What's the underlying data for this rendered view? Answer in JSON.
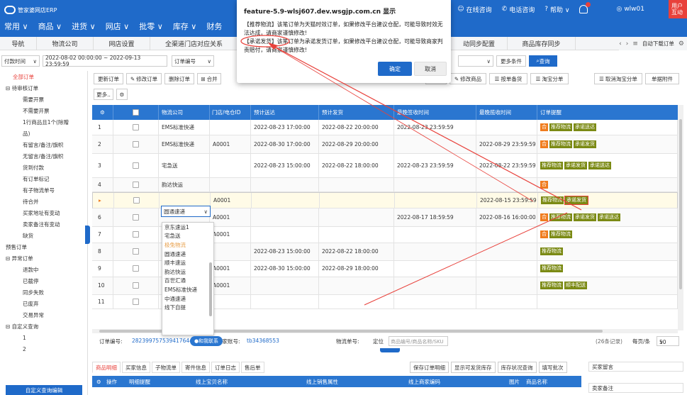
{
  "brand": {
    "name": "管家婆网店ERP"
  },
  "main_nav": [
    "常用 ∨",
    "商品 ∨",
    "进货 ∨",
    "网店 ∨",
    "批零 ∨",
    "库存 ∨",
    "财务"
  ],
  "right_nav": {
    "online": "在线咨询",
    "phone": "电话咨询",
    "help": "帮助 ∨",
    "user": "wlw01",
    "user_tag": "用户互动"
  },
  "tabs": [
    "导航",
    "物流公司",
    "网店设置",
    "全渠道门店对应关系",
    "动同步配置",
    "商品库存同步"
  ],
  "tab_download": "自动下载订单",
  "filter": {
    "time_type": "付款时间",
    "date_range": "2022-08-02 00:00:00 ~ 2022-09-13 23:59:59",
    "order_field": "订单编号",
    "more": "更多条件",
    "query": "查询"
  },
  "sidebar": [
    {
      "label": "全部订单",
      "level": "active"
    },
    {
      "label": "⊟ 待审核订单",
      "level": "l1"
    },
    {
      "label": "需要开票",
      "level": "l2"
    },
    {
      "label": "不需要开票",
      "level": "l2"
    },
    {
      "label": "1行商品且1个(除赠",
      "level": "l2"
    },
    {
      "label": "品)",
      "level": "l2"
    },
    {
      "label": "有留言/备注/旗帜",
      "level": "l2"
    },
    {
      "label": "无留言/备注/旗帜",
      "level": "l2"
    },
    {
      "label": "货到付款",
      "level": "l2"
    },
    {
      "label": "有订单标记",
      "level": "l2"
    },
    {
      "label": "有子物流单号",
      "level": "l2"
    },
    {
      "label": "待合并",
      "level": "l2"
    },
    {
      "label": "买家地址有变动",
      "level": "l2"
    },
    {
      "label": "卖家备注有变动",
      "level": "l2"
    },
    {
      "label": "缺货",
      "level": "l2"
    },
    {
      "label": "预售订单",
      "level": "l1"
    },
    {
      "label": "⊟ 异常订单",
      "level": "l1"
    },
    {
      "label": "退款中",
      "level": "l2"
    },
    {
      "label": "已截停",
      "level": "l2"
    },
    {
      "label": "同步失败",
      "level": "l2"
    },
    {
      "label": "已废弃",
      "level": "l2"
    },
    {
      "label": "交易异常",
      "level": "l2"
    },
    {
      "label": "⊟ 自定义查询",
      "level": "l1"
    },
    {
      "label": "1",
      "level": "l2"
    },
    {
      "label": "2",
      "level": "l2"
    }
  ],
  "sidebar_footer": "自定义查询编辑",
  "toolbar_row1": [
    "更新订单",
    "修改订单",
    "删除订单",
    "合并",
    "商品",
    "修改商品",
    "按单备货",
    "淘宝分单",
    "取消淘宝分单",
    "单据附件"
  ],
  "toolbar_row2": [
    "更多.."
  ],
  "grid": {
    "headers": [
      "物流公司",
      "门店/电仓ID",
      "预计送达",
      "预计发货",
      "最晚签收时间",
      "最晚揽收时间",
      "订单提醒"
    ],
    "rows": [
      {
        "n": "1",
        "logistics": "EMS标准快递",
        "store": "",
        "arrive": "2022-08-23 17:00:00",
        "ship": "2022-08-22 20:00:00",
        "sign": "2022-08-23 23:59:59",
        "pickup": "",
        "tags": [
          [
            "合",
            "o"
          ],
          [
            "推荐物流",
            "g"
          ],
          [
            "承诺送达",
            "g"
          ]
        ]
      },
      {
        "n": "2",
        "logistics": "EMS标准快递",
        "store": "A0001",
        "arrive": "2022-08-30 17:00:00",
        "ship": "2022-08-29 20:00:00",
        "sign": "",
        "pickup": "2022-08-29 23:59:59",
        "tags": [
          [
            "合",
            "o"
          ],
          [
            "推荐物流",
            "g"
          ],
          [
            "承诺发货",
            "g"
          ]
        ]
      },
      {
        "n": "3",
        "logistics": "宅急送",
        "store": "",
        "arrive": "2022-08-23 15:00:00",
        "ship": "2022-08-22 18:00:00",
        "sign": "2022-08-23 23:59:59",
        "pickup": "2022-08-22 23:59:59",
        "tags": [
          [
            "推荐物流",
            "g"
          ],
          [
            "承诺发货",
            "g"
          ],
          [
            "承诺送达",
            "g"
          ]
        ]
      },
      {
        "n": "4",
        "logistics": "韵达快运",
        "store": "",
        "arrive": "",
        "ship": "",
        "sign": "",
        "pickup": "",
        "tags": [
          [
            "合",
            "o"
          ]
        ]
      },
      {
        "n": "▸",
        "logistics": "",
        "store": "A0001",
        "arrive": "",
        "ship": "",
        "sign": "",
        "pickup": "2022-08-15 23:59:59",
        "tags": [
          [
            "推荐物流",
            "g"
          ],
          [
            "承诺发货",
            "g"
          ]
        ]
      },
      {
        "n": "6",
        "logistics": "",
        "store": "A0001",
        "arrive": "",
        "ship": "",
        "sign": "2022-08-17 18:59:59",
        "pickup": "2022-08-16 16:00:00",
        "tags": [
          [
            "合",
            "o"
          ],
          [
            "推荐物流",
            "g"
          ],
          [
            "承诺发货",
            "g"
          ],
          [
            "承诺送达",
            "g"
          ]
        ]
      },
      {
        "n": "7",
        "logistics": "",
        "store": "A0001",
        "arrive": "",
        "ship": "",
        "sign": "",
        "pickup": "",
        "tags": [
          [
            "合",
            "o"
          ],
          [
            "推荐物流",
            "g"
          ]
        ]
      },
      {
        "n": "8",
        "logistics": "",
        "store": "",
        "arrive": "2022-08-23 15:00:00",
        "ship": "2022-08-22 18:00:00",
        "sign": "",
        "pickup": "",
        "tags": [
          [
            "推荐物流",
            "g"
          ]
        ]
      },
      {
        "n": "9",
        "logistics": "",
        "store": "A0001",
        "arrive": "2022-08-30 15:00:00",
        "ship": "2022-08-29 18:00:00",
        "sign": "",
        "pickup": "",
        "tags": [
          [
            "推荐物流",
            "g"
          ]
        ]
      },
      {
        "n": "10",
        "logistics": "",
        "store": "A0001",
        "arrive": "",
        "ship": "",
        "sign": "",
        "pickup": "",
        "tags": [
          [
            "推荐物流",
            "g"
          ],
          [
            "顺丰配送",
            "g"
          ]
        ]
      },
      {
        "n": "11",
        "logistics": "",
        "store": "",
        "arrive": "",
        "ship": "",
        "sign": "",
        "pickup": "",
        "tags": []
      }
    ]
  },
  "combo_value": "圆通速递",
  "dropdown_options": [
    "京东速运1",
    "宅急送",
    "极兔物流",
    "圆通速递",
    "顺丰速运",
    "韵达快运",
    "百世汇通",
    "EMS标准快递",
    "中通速递",
    "线下自提"
  ],
  "status_bar": {
    "order_no_label": "订单编号:",
    "order_no": "2823997575394176444",
    "buyer_label": "买家账号:",
    "buyer": "tb34368553",
    "contact": "和我联系",
    "logistics_label": "物流单号:",
    "locate_label": "定位",
    "locate_placeholder": "商品编号/商品名称/SKU",
    "count": "(26条记录)",
    "per_page_label": "每页/条",
    "per_page": "50"
  },
  "bottom_tabs": [
    "商品明细",
    "买家信息",
    "子物流单",
    "寄件信息",
    "订单日志",
    "售后单"
  ],
  "bottom_buttons": [
    "保存订单明细",
    "显示可发货库存",
    "库存状况查询",
    "填写批次"
  ],
  "bottom_headers": [
    "操作",
    "明细提醒",
    "线上宝贝名称",
    "线上销售属性",
    "线上商家编码",
    "图片",
    "商品名称"
  ],
  "right_panel": [
    "买家留言",
    "卖家备注"
  ],
  "dialog": {
    "title": "feature-5.9-wlsj607.dev.wsgjp.com.cn 显示",
    "msg1": "【推荐物流】该笔订单为天猫时效订单，如果修改平台建议仓配，可能导致时效无法达成，请商家谨慎修改!",
    "msg2": "【承诺发货】该笔订单为承诺发货订单，如果修改平台建议仓配，可能导致商家判责赔付，请商家谨慎修改!",
    "ok": "确定",
    "cancel": "取消"
  },
  "colors": {
    "brand_blue": "#1f6ac9",
    "header_blue": "#2a76d0",
    "alert_red": "#e8413b",
    "tag_green": "#7b8a14",
    "tag_orange": "#f07c1e"
  }
}
